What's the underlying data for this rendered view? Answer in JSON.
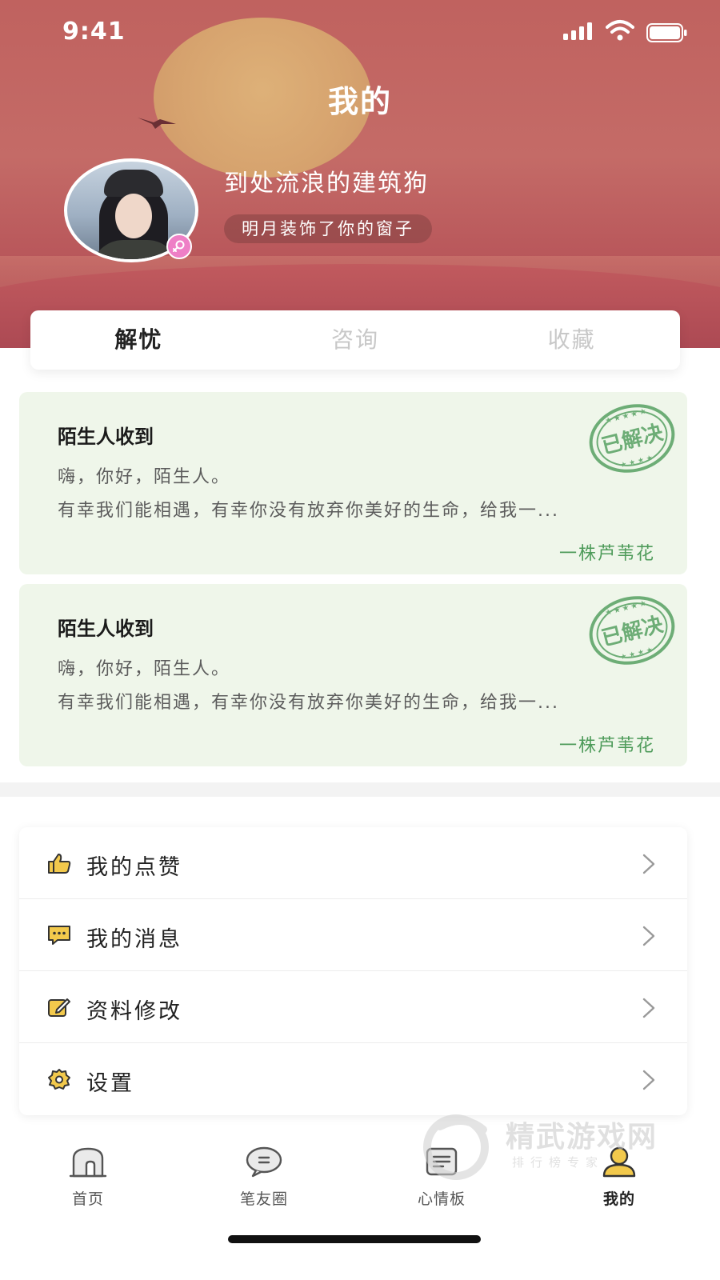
{
  "status_bar": {
    "time": "9:41"
  },
  "header": {
    "title": "我的",
    "nickname": "到处流浪的建筑狗",
    "signature": "明月装饰了你的窗子",
    "gender": "female"
  },
  "tabs": [
    {
      "label": "解忧",
      "active": true
    },
    {
      "label": "咨询",
      "active": false
    },
    {
      "label": "收藏",
      "active": false
    }
  ],
  "letters": [
    {
      "title": "陌生人收到",
      "line1": "嗨，你好，陌生人。",
      "line2": "有幸我们能相遇，有幸你没有放弃你美好的生命，给我一...",
      "author": "一株芦苇花",
      "stamp": "已解决"
    },
    {
      "title": "陌生人收到",
      "line1": "嗨，你好，陌生人。",
      "line2": "有幸我们能相遇，有幸你没有放弃你美好的生命，给我一...",
      "author": "一株芦苇花",
      "stamp": "已解决"
    }
  ],
  "menu": [
    {
      "label": "我的点赞",
      "icon": "thumbs-up-icon"
    },
    {
      "label": "我的消息",
      "icon": "message-icon"
    },
    {
      "label": "资料修改",
      "icon": "edit-icon"
    },
    {
      "label": "设置",
      "icon": "gear-icon"
    }
  ],
  "tabbar": [
    {
      "label": "首页",
      "icon": "home-icon",
      "active": false
    },
    {
      "label": "笔友圈",
      "icon": "chat-bubble-icon",
      "active": false
    },
    {
      "label": "心情板",
      "icon": "board-icon",
      "active": false
    },
    {
      "label": "我的",
      "icon": "user-icon",
      "active": true
    }
  ],
  "watermark": {
    "title": "精武游戏网",
    "subtitle": "排行榜专家"
  },
  "colors": {
    "header_bg": "#c0625f",
    "accent_yellow": "#f2d43a",
    "card_bg": "#eff6ea",
    "author_green": "#4e9b5a",
    "menu_icon": "#e9b23c"
  }
}
